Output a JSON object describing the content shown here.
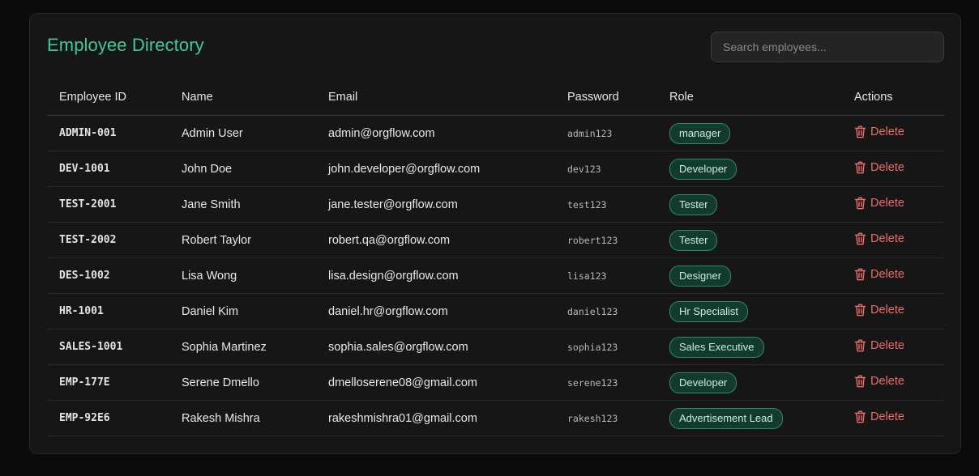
{
  "header": {
    "title": "Employee Directory",
    "search_placeholder": "Search employees..."
  },
  "table": {
    "columns": [
      "Employee ID",
      "Name",
      "Email",
      "Password",
      "Role",
      "Actions"
    ],
    "delete_label": "Delete",
    "rows": [
      {
        "id": "ADMIN-001",
        "name": "Admin User",
        "email": "admin@orgflow.com",
        "password": "admin123",
        "role": "manager"
      },
      {
        "id": "DEV-1001",
        "name": "John Doe",
        "email": "john.developer@orgflow.com",
        "password": "dev123",
        "role": "Developer"
      },
      {
        "id": "TEST-2001",
        "name": "Jane Smith",
        "email": "jane.tester@orgflow.com",
        "password": "test123",
        "role": "Tester"
      },
      {
        "id": "TEST-2002",
        "name": "Robert Taylor",
        "email": "robert.qa@orgflow.com",
        "password": "robert123",
        "role": "Tester"
      },
      {
        "id": "DES-1002",
        "name": "Lisa Wong",
        "email": "lisa.design@orgflow.com",
        "password": "lisa123",
        "role": "Designer"
      },
      {
        "id": "HR-1001",
        "name": "Daniel Kim",
        "email": "daniel.hr@orgflow.com",
        "password": "daniel123",
        "role": "Hr Specialist"
      },
      {
        "id": "SALES-1001",
        "name": "Sophia Martinez",
        "email": "sophia.sales@orgflow.com",
        "password": "sophia123",
        "role": "Sales Executive"
      },
      {
        "id": "EMP-177E",
        "name": "Serene Dmello",
        "email": "dmelloserene08@gmail.com",
        "password": "serene123",
        "role": "Developer"
      },
      {
        "id": "EMP-92E6",
        "name": "Rakesh Mishra",
        "email": "rakeshmishra01@gmail.com",
        "password": "rakesh123",
        "role": "Advertisement Lead"
      }
    ]
  },
  "colors": {
    "accent": "#3ec99a",
    "danger": "#ef6b6b",
    "badge_bg": "#143a2d",
    "badge_border": "#2f8a6a"
  },
  "icons": {
    "delete": "trash-icon"
  }
}
